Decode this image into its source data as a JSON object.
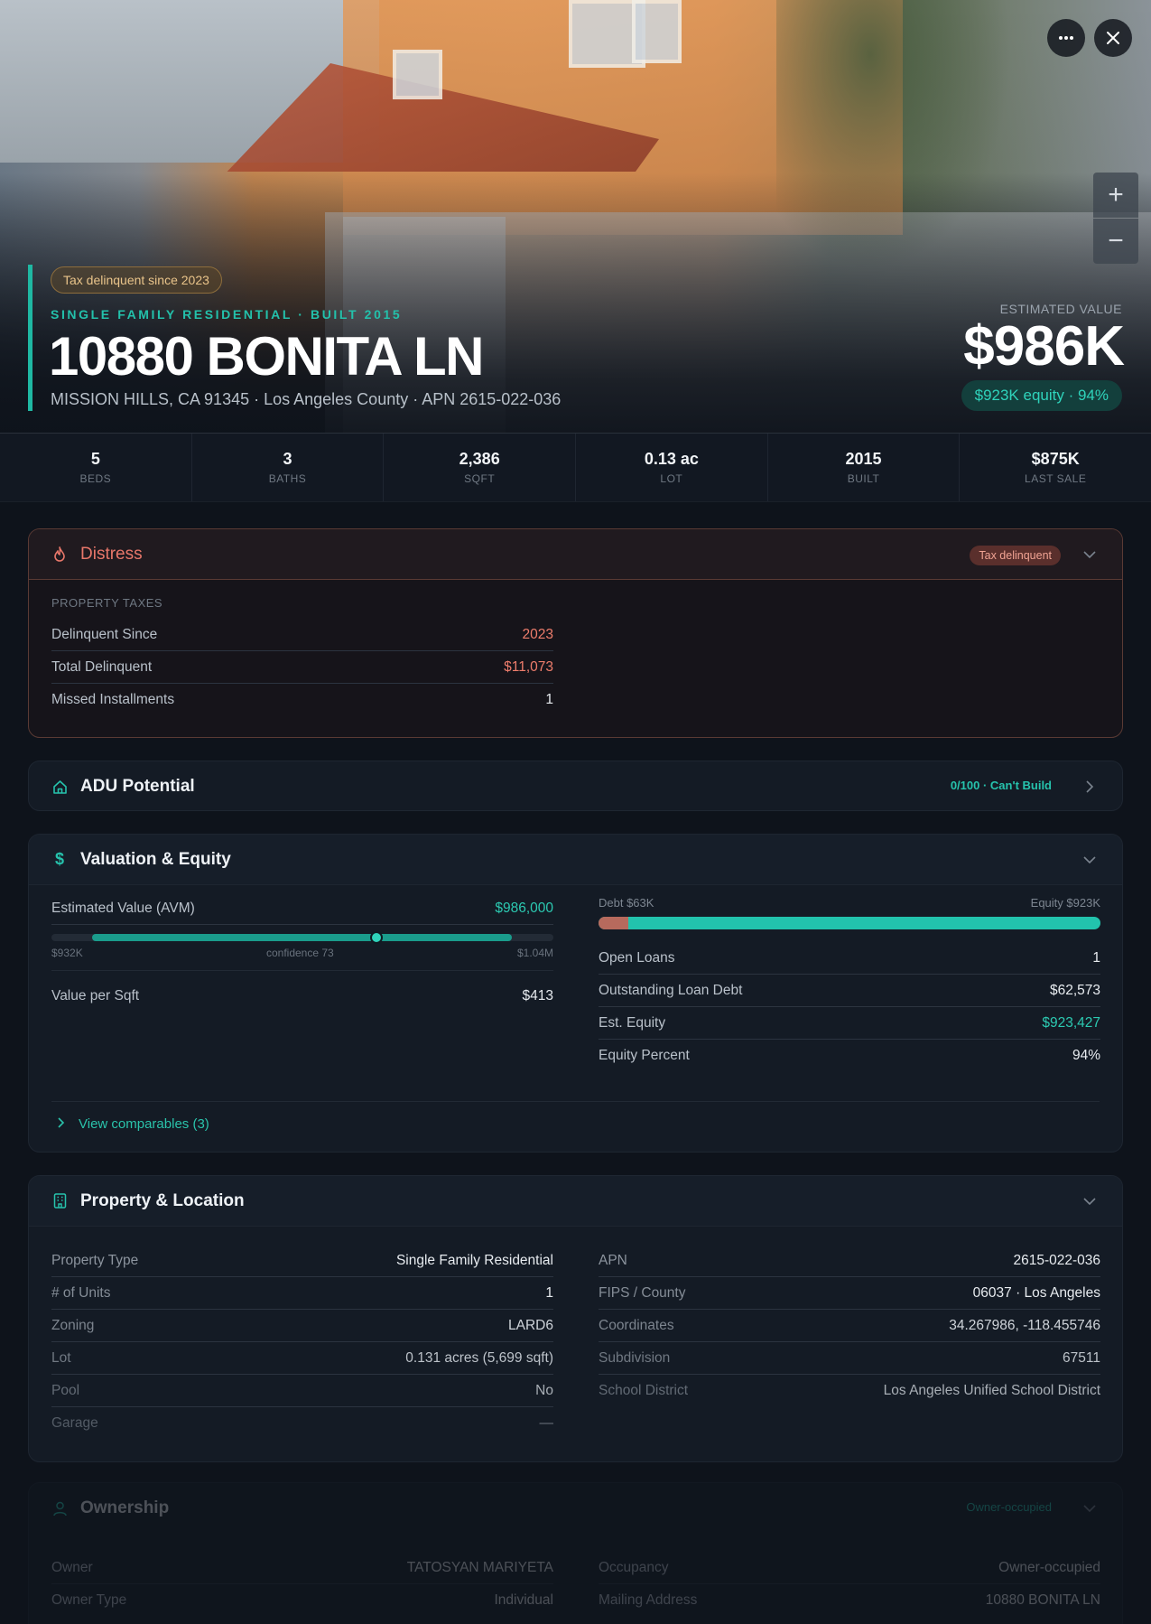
{
  "hero": {
    "tax_pill": "Tax delinquent since 2023",
    "kicker": "SINGLE FAMILY RESIDENTIAL · BUILT 2015",
    "title": "10880 BONITA LN",
    "subtitle": "MISSION HILLS, CA 91345 · Los Angeles County · APN 2615-022-036",
    "est_label": "ESTIMATED VALUE",
    "est_value": "$986K",
    "equity_pill": "$923K equity · 94%"
  },
  "stats": [
    {
      "value": "5",
      "label": "BEDS"
    },
    {
      "value": "3",
      "label": "BATHS"
    },
    {
      "value": "2,386",
      "label": "SQFT"
    },
    {
      "value": "0.13 ac",
      "label": "LOT"
    },
    {
      "value": "2015",
      "label": "BUILT"
    },
    {
      "value": "$875K",
      "label": "LAST SALE"
    }
  ],
  "distress": {
    "title": "Distress",
    "tag": "Tax delinquent",
    "section": "PROPERTY TAXES",
    "rows": [
      {
        "k": "Delinquent Since",
        "v": "2023"
      },
      {
        "k": "Total Delinquent",
        "v": "$11,073"
      },
      {
        "k": "Missed Installments",
        "v": "1"
      }
    ]
  },
  "adu": {
    "title": "ADU Potential",
    "tag": "0/100 · Can't Build"
  },
  "valuation": {
    "title": "Valuation & Equity",
    "avm_label": "Estimated Value (AVM)",
    "avm_value": "$986,000",
    "avm_low": "$932K",
    "avm_conf": "confidence 73",
    "avm_high": "$1.04M",
    "avm_confidence_pct": 73,
    "vps_label": "Value per Sqft",
    "vps_value": "$413",
    "debt_label": "Debt $63K",
    "equity_label": "Equity $923K",
    "debt_fraction": 0.06,
    "rows": [
      {
        "k": "Open Loans",
        "v": "1"
      },
      {
        "k": "Outstanding Loan Debt",
        "v": "$62,573"
      },
      {
        "k": "Est. Equity",
        "v": "$923,427"
      },
      {
        "k": "Equity Percent",
        "v": "94%"
      }
    ],
    "comps": "View comparables (3)"
  },
  "property": {
    "title": "Property & Location",
    "left": [
      {
        "k": "Property Type",
        "v": "Single Family Residential"
      },
      {
        "k": "# of Units",
        "v": "1"
      },
      {
        "k": "Zoning",
        "v": "LARD6"
      },
      {
        "k": "Lot",
        "v": "0.131 acres (5,699 sqft)"
      },
      {
        "k": "Pool",
        "v": "No"
      },
      {
        "k": "Garage",
        "v": "—"
      }
    ],
    "right": [
      {
        "k": "APN",
        "v": "2615-022-036"
      },
      {
        "k": "FIPS / County",
        "v": "06037 · Los Angeles"
      },
      {
        "k": "Coordinates",
        "v": "34.267986, -118.455746"
      },
      {
        "k": "Subdivision",
        "v": "67511"
      },
      {
        "k": "School District",
        "v": "Los Angeles Unified School District"
      }
    ]
  },
  "ownership": {
    "title": "Ownership",
    "tag": "Owner-occupied",
    "left": [
      {
        "k": "Owner",
        "v": "TATOSYAN MARIYETA"
      },
      {
        "k": "Owner Type",
        "v": "Individual"
      }
    ],
    "right": [
      {
        "k": "Occupancy",
        "v": "Owner-occupied"
      },
      {
        "k": "Mailing Address",
        "v": "10880 BONITA LN"
      }
    ]
  },
  "colors": {
    "accent": "#1fb8a3",
    "danger": "#ee7d6c",
    "bg": "#0e131b"
  },
  "icons": {
    "more": "more-icon",
    "close": "close-icon",
    "zoom_in": "plus-icon",
    "zoom_out": "minus-icon",
    "fire": "flame-icon",
    "home": "home-icon",
    "dollar": "dollar-icon",
    "building": "building-icon",
    "user": "user-icon"
  }
}
